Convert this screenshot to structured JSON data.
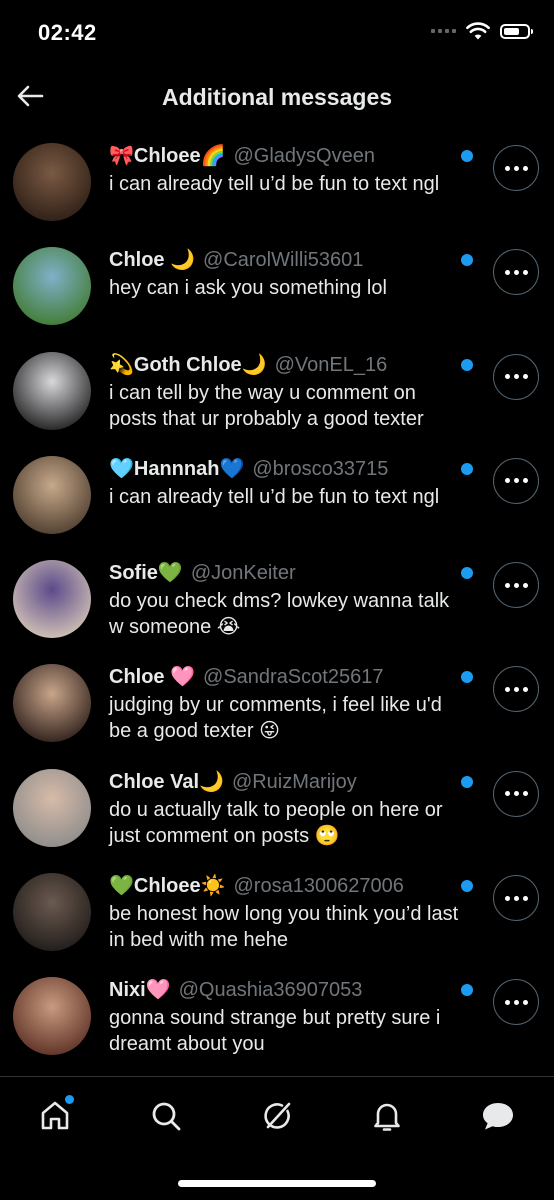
{
  "status_bar": {
    "time": "02:42"
  },
  "header": {
    "title": "Additional messages",
    "back_icon": "arrow-left-icon"
  },
  "messages": [
    {
      "name": "🎀Chloee🌈",
      "handle": "@GladysQveen",
      "preview": "i can already tell u’d be fun to text ngl",
      "unread": true,
      "avatar": [
        "#7a5a44",
        "#2c1d14"
      ]
    },
    {
      "name": "Chloe 🌙",
      "handle": "@CarolWilli53601",
      "preview": "hey can i ask you something lol",
      "unread": true,
      "avatar": [
        "#7fb0c9",
        "#3f7a2e"
      ]
    },
    {
      "name": "💫Goth Chloe🌙",
      "handle": "@VonEL_16",
      "preview": "i can tell by the way u comment on posts that ur probably a good texter",
      "unread": true,
      "avatar": [
        "#d8d8dc",
        "#1a1a1a"
      ]
    },
    {
      "name": "🩵Hannnah💙",
      "handle": "@brosco33715",
      "preview": "i can already tell u’d be fun to text ngl",
      "unread": true,
      "avatar": [
        "#c7a98b",
        "#4b3a2c"
      ]
    },
    {
      "name": "Sofie💚",
      "handle": "@JonKeiter",
      "preview": "do you check dms? lowkey wanna talk w someone 😭",
      "unread": true,
      "avatar": [
        "#5b4a8a",
        "#d8c8b8"
      ]
    },
    {
      "name": "Chloe 🩷",
      "handle": "@SandraScot25617",
      "preview": "judging by ur comments, i feel like u'd be a good texter 😜",
      "unread": true,
      "avatar": [
        "#c9a58a",
        "#2a1c18"
      ]
    },
    {
      "name": "Chloe Val🌙",
      "handle": "@RuizMarijoy",
      "preview": "do u actually talk to people on here or just comment on posts 🙄",
      "unread": true,
      "avatar": [
        "#d7bba8",
        "#8a8a8a"
      ]
    },
    {
      "name": "💚Chloee☀️",
      "handle": "@rosa1300627006",
      "preview": "be honest how long you think you’d last in bed with me hehe",
      "unread": true,
      "avatar": [
        "#6b5a50",
        "#1e1a18"
      ]
    },
    {
      "name": "Nixi🩷",
      "handle": "@Quashia36907053",
      "preview": "gonna sound strange but pretty sure i dreamt about you",
      "unread": true,
      "avatar": [
        "#c89a80",
        "#5a2e22"
      ]
    }
  ],
  "tab_bar": {
    "tabs": [
      {
        "icon": "home-icon",
        "badge": true
      },
      {
        "icon": "search-icon",
        "badge": false
      },
      {
        "icon": "grok-icon",
        "badge": false
      },
      {
        "icon": "bell-icon",
        "badge": false
      },
      {
        "icon": "messages-icon",
        "badge": false
      }
    ]
  }
}
